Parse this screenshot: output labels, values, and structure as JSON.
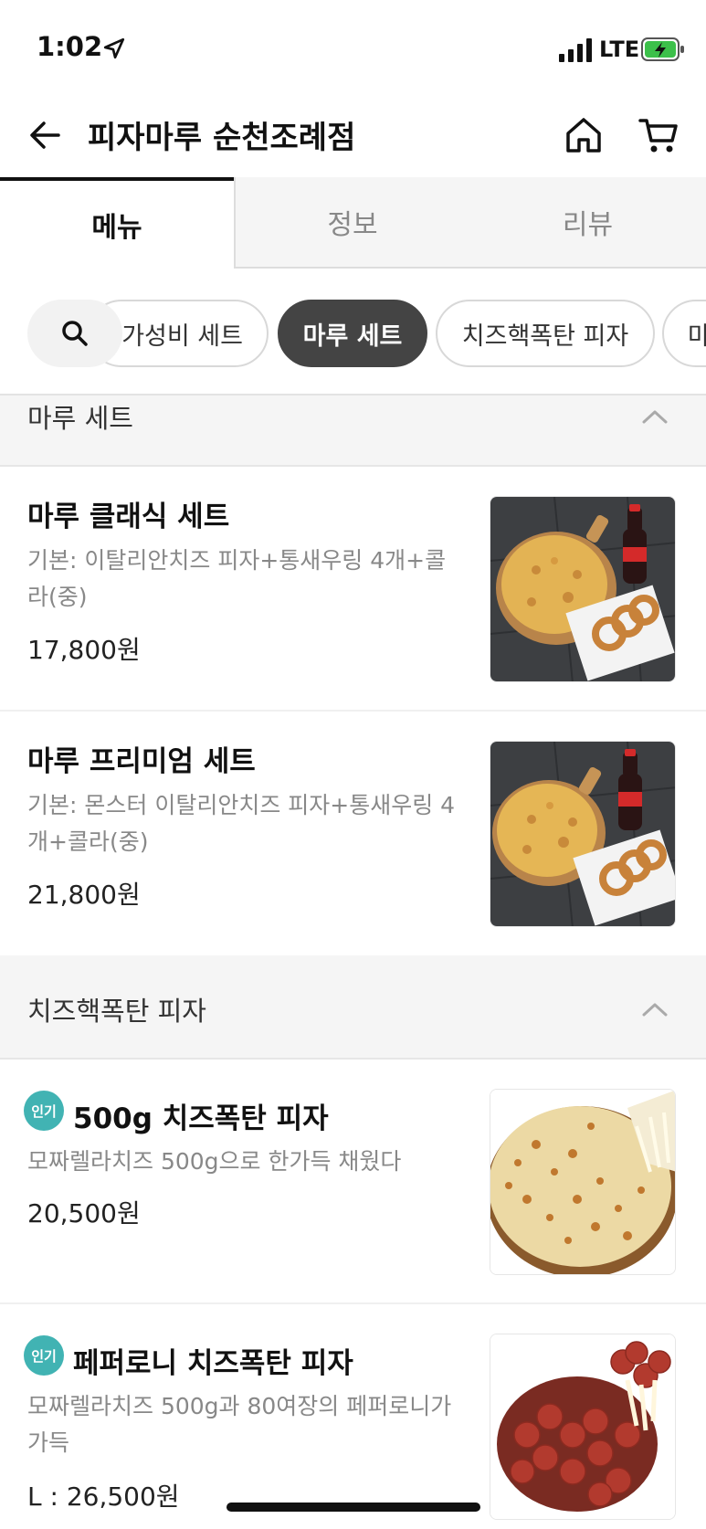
{
  "status_bar": {
    "time": "1:02",
    "network": "LTE"
  },
  "header": {
    "title": "피자마루 순천조례점"
  },
  "tabs": [
    {
      "label": "메뉴"
    },
    {
      "label": "정보"
    },
    {
      "label": "리뷰"
    }
  ],
  "categories": [
    {
      "label": "가성비 세트"
    },
    {
      "label": "마루 세트"
    },
    {
      "label": "치즈핵폭탄 피자"
    },
    {
      "label": "마"
    }
  ],
  "sections": [
    {
      "title": "마루 세트",
      "items": [
        {
          "name": "마루 클래식 세트",
          "desc": "기본: 이탈리안치즈 피자+통새우링 4개+콜라(중)",
          "price": "17,800원"
        },
        {
          "name": "마루 프리미엄 세트",
          "desc": "기본: 몬스터 이탈리안치즈 피자+통새우링 4개+콜라(중)",
          "price": "21,800원"
        }
      ]
    },
    {
      "title": "치즈핵폭탄 피자",
      "items": [
        {
          "badge": "인기",
          "name": "500g 치즈폭탄 피자",
          "desc": "모짜렐라치즈 500g으로 한가득 채웠다",
          "price": "20,500원"
        },
        {
          "badge": "인기",
          "name": "페퍼로니 치즈폭탄 피자",
          "desc": "모짜렐라치즈 500g과 80여장의 페퍼로니가 가득",
          "price": "L : 26,500원"
        }
      ]
    }
  ],
  "colors": {
    "accent_badge": "#41b3b3",
    "active_chip": "#444444"
  }
}
